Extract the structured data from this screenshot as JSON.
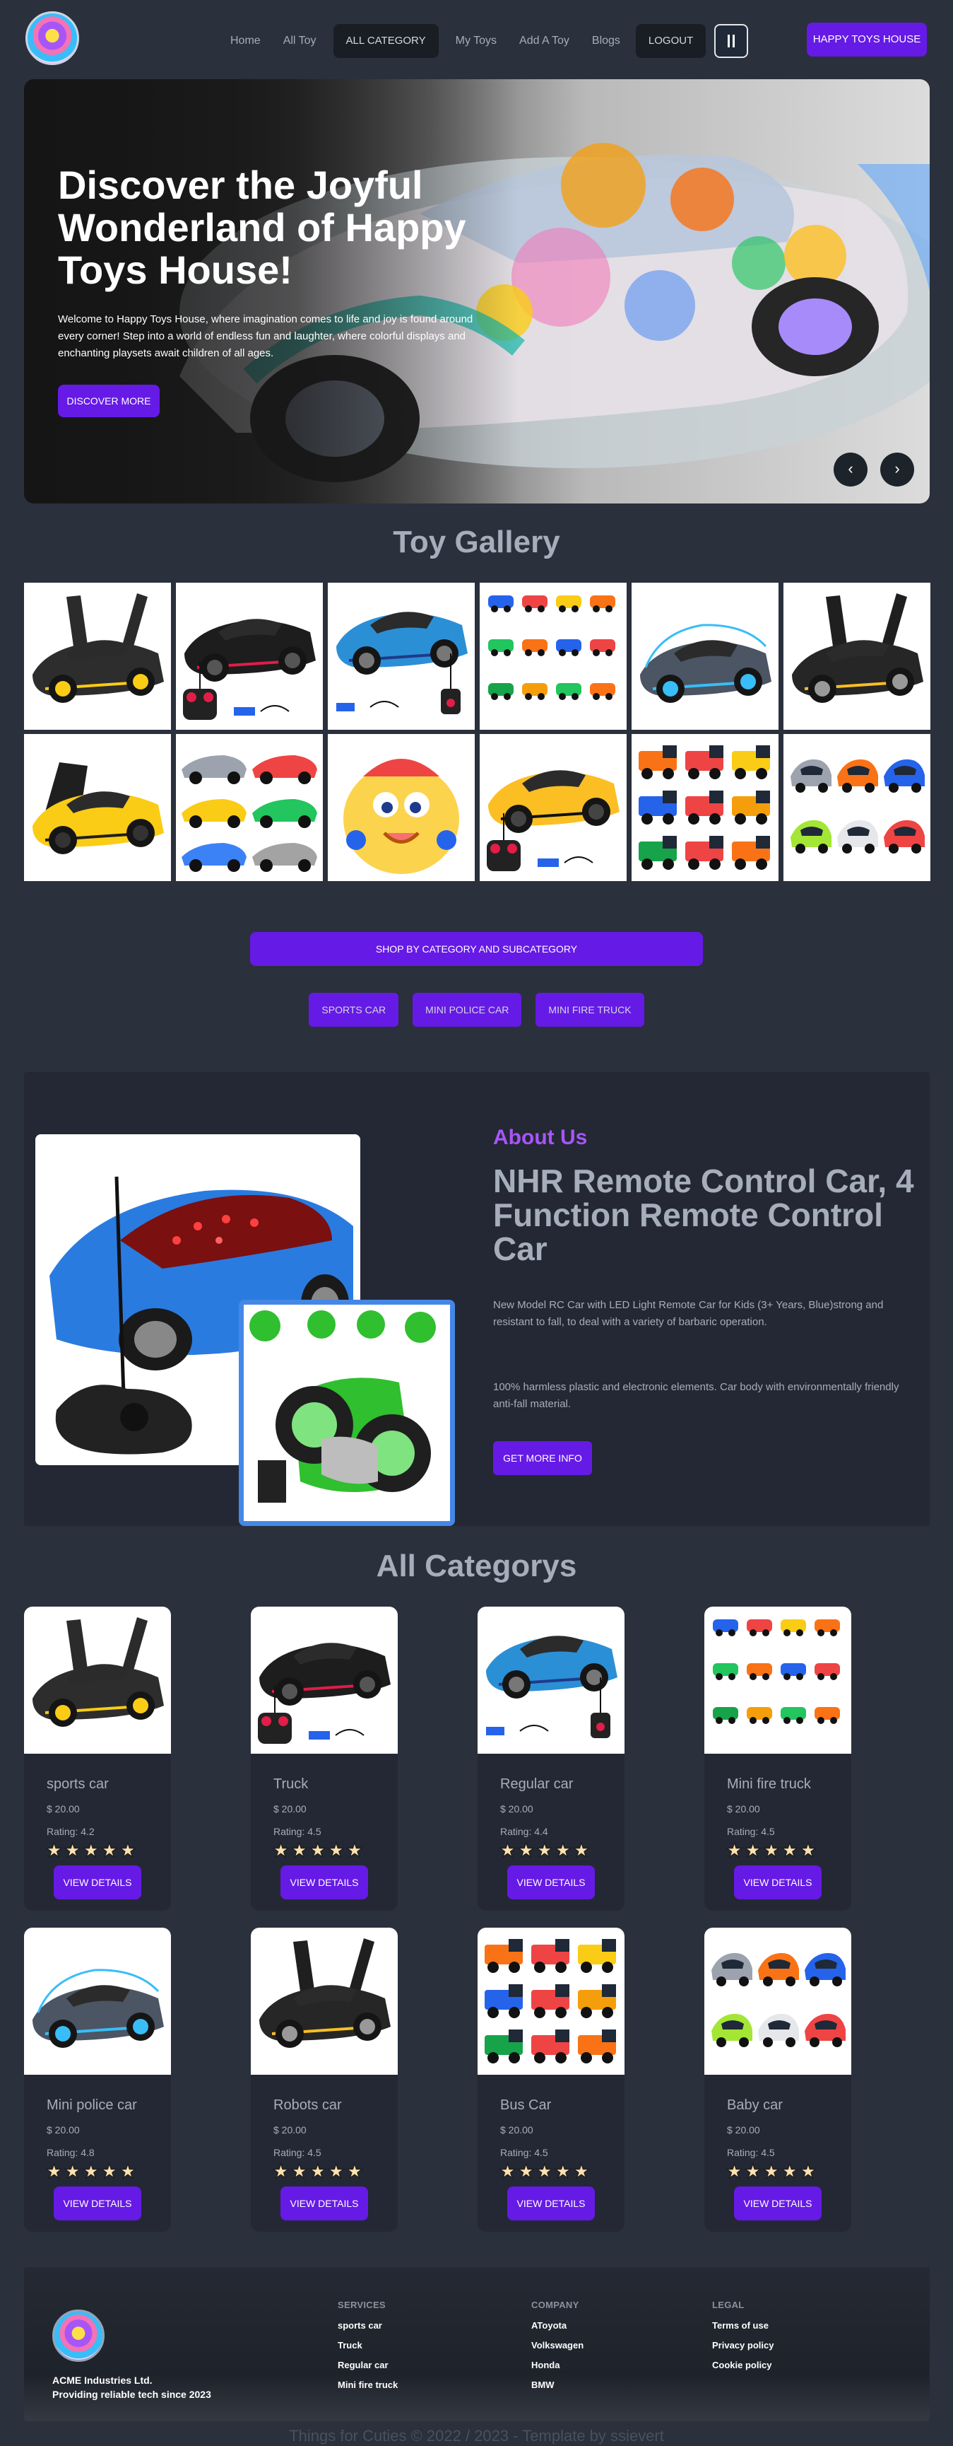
{
  "nav": {
    "links": [
      "Home",
      "All Toy",
      "ALL CATEGORY",
      "My Toys",
      "Add A Toy",
      "Blogs"
    ],
    "logout": "LOGOUT",
    "brand_button": "HAPPY TOYS HOUSE"
  },
  "hero": {
    "title": "Discover the Joyful Wonderland of Happy Toys House!",
    "text": "Welcome to Happy Toys House, where imagination comes to life and joy is found around every corner! Step into a world of endless fun and laughter, where colorful displays and enchanting playsets await children of all ages.",
    "button": "DISCOVER MORE",
    "prev": "‹",
    "next": "›"
  },
  "gallery": {
    "title": "Toy Gallery",
    "images": [
      "sports-car-black-yellow",
      "rc-car-black-red",
      "rc-suv-blue",
      "mini-trucks-set",
      "police-car-grey-blue",
      "robot-car-black",
      "sports-car-yellow",
      "racing-cars-set",
      "cartoon-toy-yellow",
      "rc-car-yellow",
      "fire-trucks-set",
      "baby-cars-set"
    ]
  },
  "shop": {
    "bar": "SHOP BY CATEGORY AND SUBCATEGORY",
    "tabs": [
      "SPORTS CAR",
      "MINI POLICE CAR",
      "MINI FIRE TRUCK"
    ]
  },
  "about": {
    "kicker": "About Us",
    "title": "NHR Remote Control Car, 4 Function Remote Control Car",
    "p1": "New Model RC Car with LED Light Remote Car for Kids (3+ Years, Blue)strong and resistant to fall, to deal with a variety of barbaric operation.",
    "p2": "100% harmless plastic and electronic elements. Car body with environmentally friendly anti-fall material.",
    "button": "GET MORE INFO"
  },
  "categories": {
    "title": "All Categorys",
    "items": [
      {
        "name": "sports car",
        "price": "$ 20.00",
        "rating": "Rating: 4.2",
        "image": "sports-car-black-yellow"
      },
      {
        "name": "Truck",
        "price": "$ 20.00",
        "rating": "Rating: 4.5",
        "image": "rc-car-black-red"
      },
      {
        "name": "Regular car",
        "price": "$ 20.00",
        "rating": "Rating: 4.4",
        "image": "rc-suv-blue"
      },
      {
        "name": "Mini fire truck",
        "price": "$ 20.00",
        "rating": "Rating: 4.5",
        "image": "mini-trucks-set"
      },
      {
        "name": "Mini police car",
        "price": "$ 20.00",
        "rating": "Rating: 4.8",
        "image": "police-car-grey-blue"
      },
      {
        "name": "Robots car",
        "price": "$ 20.00",
        "rating": "Rating: 4.5",
        "image": "robot-car-black"
      },
      {
        "name": "Bus Car",
        "price": "$ 20.00",
        "rating": "Rating: 4.5",
        "image": "fire-trucks-set"
      },
      {
        "name": "Baby car",
        "price": "$ 20.00",
        "rating": "Rating: 4.5",
        "image": "baby-cars-set"
      }
    ],
    "stars": "★★★★★",
    "button": "VIEW DETAILS"
  },
  "footer": {
    "brand_line1": "ACME Industries Ltd.",
    "brand_line2": "Providing reliable tech since 2023",
    "columns": [
      {
        "title": "SERVICES",
        "links": [
          "sports car",
          "Truck",
          "Regular car",
          "Mini fire truck"
        ]
      },
      {
        "title": "COMPANY",
        "links": [
          "AToyota",
          "Volkswagen",
          "Honda",
          "BMW"
        ]
      },
      {
        "title": "LEGAL",
        "links": [
          "Terms of use",
          "Privacy policy",
          "Cookie policy"
        ]
      }
    ],
    "copyright": "Things for Cuties © 2022 / 2023 - Template by ssievert"
  },
  "colors": {
    "background": "#2a303c",
    "primary": "#661ae6",
    "accent_purple": "#a855f7",
    "card": "#232834"
  }
}
